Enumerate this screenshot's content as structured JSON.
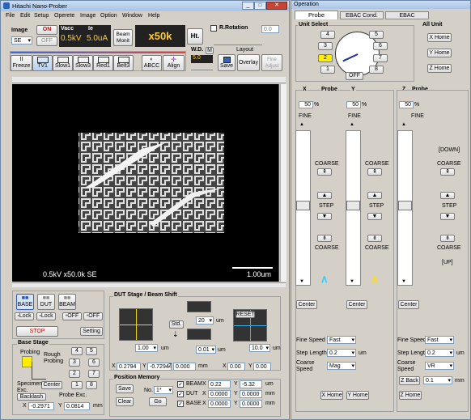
{
  "left_window": {
    "title": "Hitachi Nano-Prober",
    "menu": [
      "File",
      "Edit",
      "Setup",
      "Operete",
      "Image",
      "Option",
      "Window",
      "Help"
    ],
    "image_label": "Image",
    "image_value": "SE",
    "on_label": "ON",
    "off_label": "OFF",
    "vacc_label": "Vacc",
    "vacc_value": "0.5kV",
    "ie_label": "Ie",
    "ie_value": "5.0uA",
    "beam_monit": "Beam\nMonit",
    "mag_value": "x50k",
    "ht_label": "Ht.",
    "rrotation_label": "R.Rotation",
    "rrot_value": "0.0",
    "toolbar": [
      "Freeze",
      "TV1",
      "Slow1",
      "Slow3",
      "Red1",
      "Belt3",
      "ABCC",
      "Align"
    ],
    "wd_label": "W.D.",
    "wd_m": "M",
    "wd_value": "5.0",
    "layout_label": "Layout",
    "save_label": "Save",
    "overlay_label": "Overlay",
    "fine_adjust": "Fine\nAdjust",
    "image_info": "0.5kV x50.0k SE",
    "scale_bar": "1.00um",
    "base_label": "BASE",
    "dut_label": "DUT",
    "beam_label": "BEAM",
    "lock1": "Lock",
    "lock2": "Lock",
    "off1": "OFF",
    "off2": "OFF",
    "stop_label": "STOP",
    "setting_label": "Setting",
    "dut_stage_title": "DUT Stage / Beam Shift",
    "std_label": "Std.",
    "reset_label": "RESET",
    "um_labels": [
      "um",
      "um",
      "um",
      "um"
    ],
    "step_left": "1.00",
    "step_mid1": "20",
    "step_mid2": "0.01",
    "step_right": "10.0",
    "coord_x1": "0.2794",
    "coord_y1": "-0.7294",
    "coord_z": "0.000",
    "coord_x2": "0.00",
    "coord_y2": "0.00",
    "mm_labels": [
      "mm",
      "mm"
    ],
    "base_stage_title": "Base Stage",
    "probing": "Probing",
    "rough_probing": "Rough\nProbing",
    "bs_buttons": [
      "4",
      "5",
      "3",
      "6",
      "2",
      "7",
      "1",
      "8"
    ],
    "center_label": "Center",
    "specimen_exc": "Specimen\nExc.",
    "backlash": "Backlash",
    "probe_exc": "Probe Exc.",
    "base_x": "-0.2971",
    "base_y": "0.0814",
    "base_mm": "mm",
    "pos_mem_title": "Position Memory",
    "pm_save": "Save",
    "pm_no": "No.",
    "pm_no_val": "1*",
    "pm_clear": "Clear",
    "pm_go": "Go",
    "pm_rows": [
      {
        "name": "BEAM",
        "x": "0.22",
        "y": "-5.32",
        "unit": "um"
      },
      {
        "name": "DUT",
        "x": "0.0000",
        "y": "0.0000",
        "unit": "mm"
      },
      {
        "name": "BASE",
        "x": "0.0000",
        "y": "0.0000",
        "unit": "mm"
      }
    ]
  },
  "right_window": {
    "title": "Operation",
    "tabs": [
      "Probe",
      "EBAC Cond.",
      "EBAC"
    ],
    "unit_select": "Unit Select",
    "all_unit": "All Unit",
    "dial_numbers": [
      "4",
      "5",
      "3",
      "6",
      "2",
      "7",
      "1",
      "8"
    ],
    "dial_off": "OFF",
    "x_home_btn": "X Home",
    "y_home_btn": "Y Home",
    "z_home_btn": "Z Home",
    "x_probe": "X",
    "probe_label": "Probe",
    "y_label": "Y",
    "z_label": "Z",
    "probe_label2": "Probe",
    "pct_x": "50",
    "pct_y": "50",
    "pct_z": "50",
    "pct_sign": "%",
    "fine": "FINE",
    "coarse": "COARSE",
    "step": "STEP",
    "down": "[DOWN]",
    "up": "[UP]",
    "center": "Center",
    "fine_speed": "Fine Speed",
    "fine_speed_val": "Fast",
    "fine_speed_val2": "Fast",
    "step_length": "Step Length",
    "step_len_val": "0.2",
    "step_len_val2": "0.2",
    "um": "um",
    "coarse_speed": "Coarse\nSpeed",
    "coarse_speed_val": "Mag",
    "coarse_speed_val2": "VR",
    "z_back": "Z Back",
    "z_back_val": "0.1",
    "mm": "mm",
    "x_home": "X Home",
    "y_home": "Y Home",
    "z_home": "Z Home"
  }
}
